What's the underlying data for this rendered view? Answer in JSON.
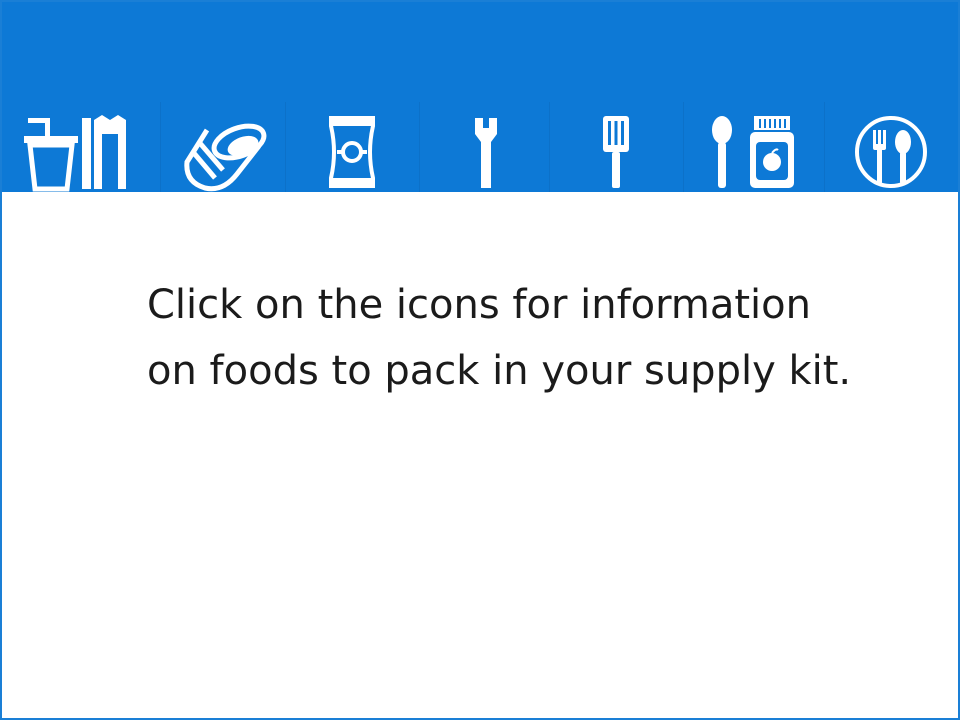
{
  "accent_color": "#0d79d6",
  "icons": [
    {
      "name": "drinks-icon",
      "label": ""
    },
    {
      "name": "canned-food-icon",
      "label": ""
    },
    {
      "name": "snack-bag-icon",
      "label": ""
    },
    {
      "name": "can-opener-icon",
      "label": ""
    },
    {
      "name": "spatula-icon",
      "label": ""
    },
    {
      "name": "baby-food-icon",
      "label": ""
    },
    {
      "name": "plate-utensils-icon",
      "label": ""
    }
  ],
  "message": "Click on the icons for information on foods to pack in your supply kit."
}
